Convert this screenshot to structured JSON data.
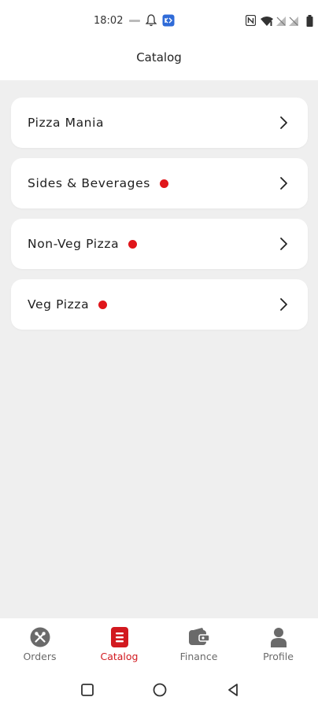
{
  "status_bar": {
    "time": "18:02",
    "icons": [
      "data-speed-icon",
      "bell-icon",
      "app-notification-icon",
      "nfc-icon",
      "wifi-icon",
      "no-signal-icon",
      "no-signal-icon",
      "battery-icon"
    ]
  },
  "header": {
    "title": "Catalog"
  },
  "catalog": {
    "items": [
      {
        "label": "Pizza Mania",
        "has_new": false
      },
      {
        "label": "Sides & Beverages",
        "has_new": true
      },
      {
        "label": "Non-Veg Pizza",
        "has_new": true
      },
      {
        "label": "Veg Pizza",
        "has_new": true
      }
    ]
  },
  "bottom_nav": {
    "items": [
      {
        "label": "Orders",
        "icon": "fork-knife-icon",
        "active": false
      },
      {
        "label": "Catalog",
        "icon": "menu-list-icon",
        "active": true
      },
      {
        "label": "Finance",
        "icon": "wallet-icon",
        "active": false
      },
      {
        "label": "Profile",
        "icon": "person-icon",
        "active": false
      }
    ]
  },
  "colors": {
    "accent": "#d2191f",
    "new_dot": "#e0161b",
    "background": "#efefef",
    "card": "#ffffff",
    "inactive_nav": "#6a6a6a"
  }
}
